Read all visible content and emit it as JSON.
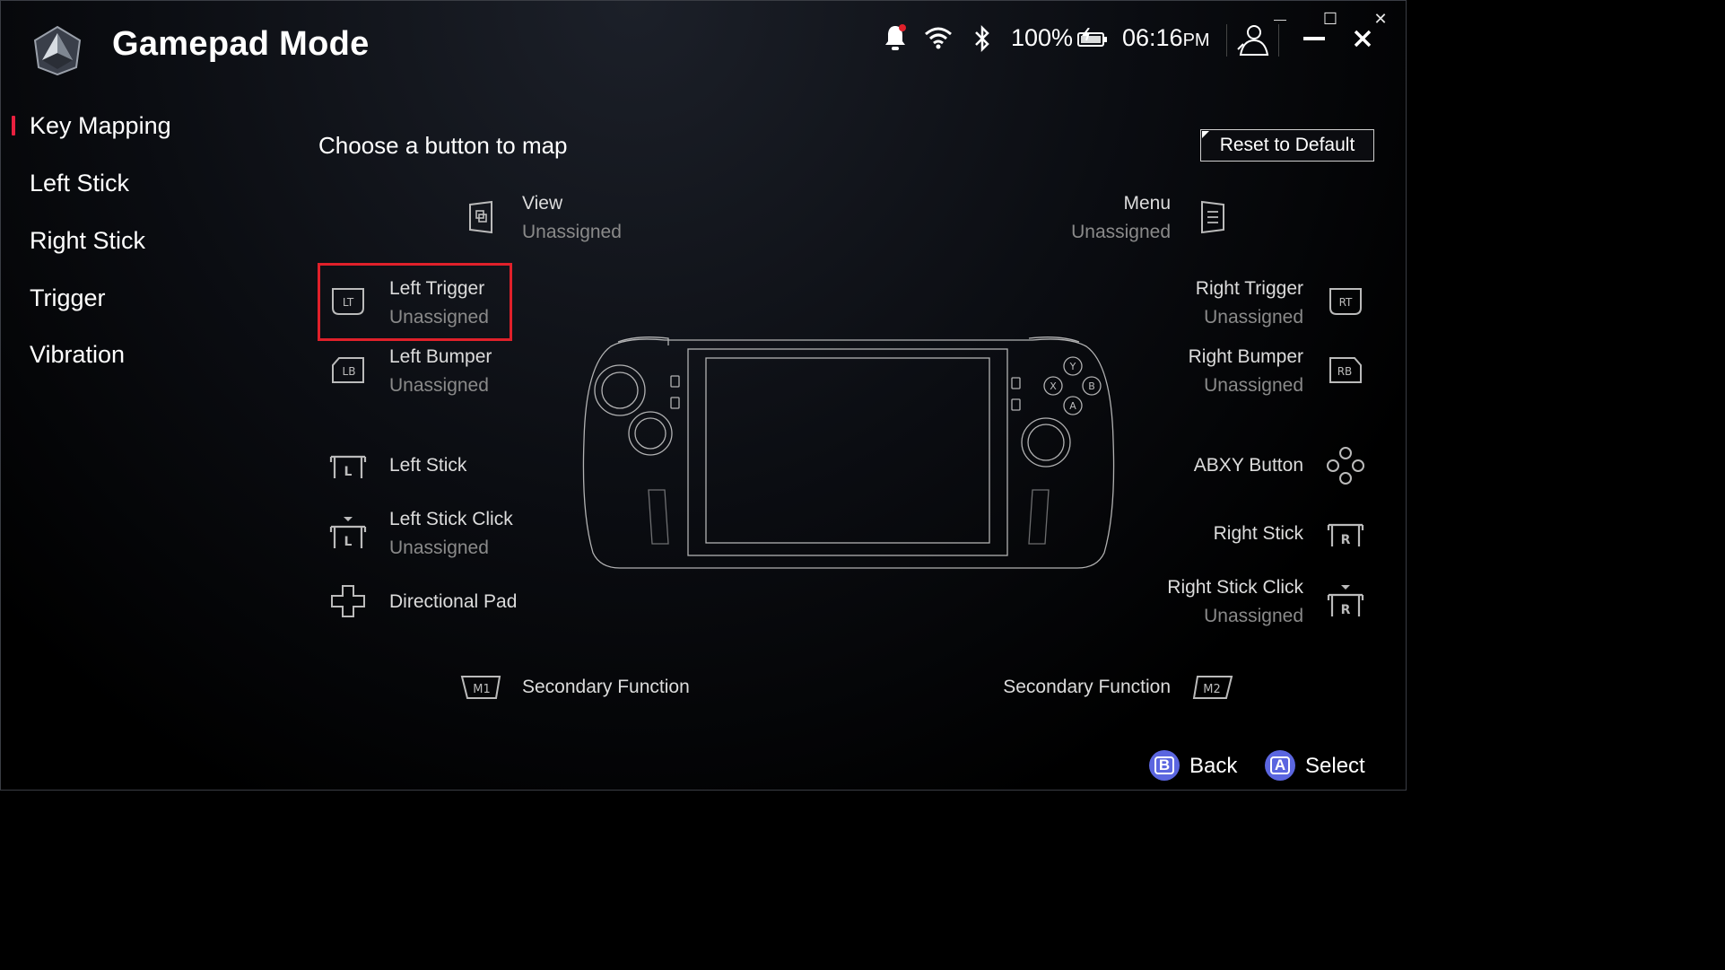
{
  "window": {
    "minimize_glyph": "—",
    "maximize_glyph": "☐",
    "close_glyph": "✕"
  },
  "header": {
    "title": "Gamepad Mode",
    "battery_percent": "100%",
    "time": "06:16",
    "time_suffix": "PM",
    "icons": [
      "bell-icon",
      "wifi-icon",
      "bluetooth-icon",
      "battery-charging-icon",
      "user-icon",
      "minimize-icon",
      "close-icon"
    ]
  },
  "sidebar": {
    "items": [
      {
        "label": "Key Mapping",
        "active": true
      },
      {
        "label": "Left Stick"
      },
      {
        "label": "Right Stick"
      },
      {
        "label": "Trigger"
      },
      {
        "label": "Vibration"
      }
    ]
  },
  "main": {
    "heading": "Choose a button to map",
    "reset_label": "Reset to Default",
    "view": {
      "label": "View",
      "value": "Unassigned"
    },
    "menu": {
      "label": "Menu",
      "value": "Unassigned"
    },
    "left_trigger": {
      "label": "Left Trigger",
      "value": "Unassigned",
      "icon_text": "LT"
    },
    "left_bumper": {
      "label": "Left Bumper",
      "value": "Unassigned",
      "icon_text": "LB"
    },
    "left_stick": {
      "label": "Left Stick",
      "icon_text": "L"
    },
    "left_stick_click": {
      "label": "Left Stick Click",
      "value": "Unassigned",
      "icon_text": "L"
    },
    "dpad": {
      "label": "Directional Pad"
    },
    "secondary_left": {
      "label": "Secondary Function",
      "icon_text": "M1"
    },
    "right_trigger": {
      "label": "Right Trigger",
      "value": "Unassigned",
      "icon_text": "RT"
    },
    "right_bumper": {
      "label": "Right Bumper",
      "value": "Unassigned",
      "icon_text": "RB"
    },
    "abxy": {
      "label": "ABXY Button"
    },
    "right_stick": {
      "label": "Right Stick",
      "icon_text": "R"
    },
    "right_stick_click": {
      "label": "Right Stick Click",
      "value": "Unassigned",
      "icon_text": "R"
    },
    "secondary_right": {
      "label": "Secondary Function",
      "icon_text": "M2"
    },
    "device_buttons": {
      "y": "Y",
      "x": "X",
      "b": "B",
      "a": "A"
    }
  },
  "footer": {
    "back": {
      "label": "Back",
      "glyph": "B"
    },
    "select": {
      "label": "Select",
      "glyph": "A"
    }
  },
  "colors": {
    "accent_red": "#e0202a",
    "hint_blue": "#5b66e0",
    "muted_text": "#8a8a8a"
  }
}
